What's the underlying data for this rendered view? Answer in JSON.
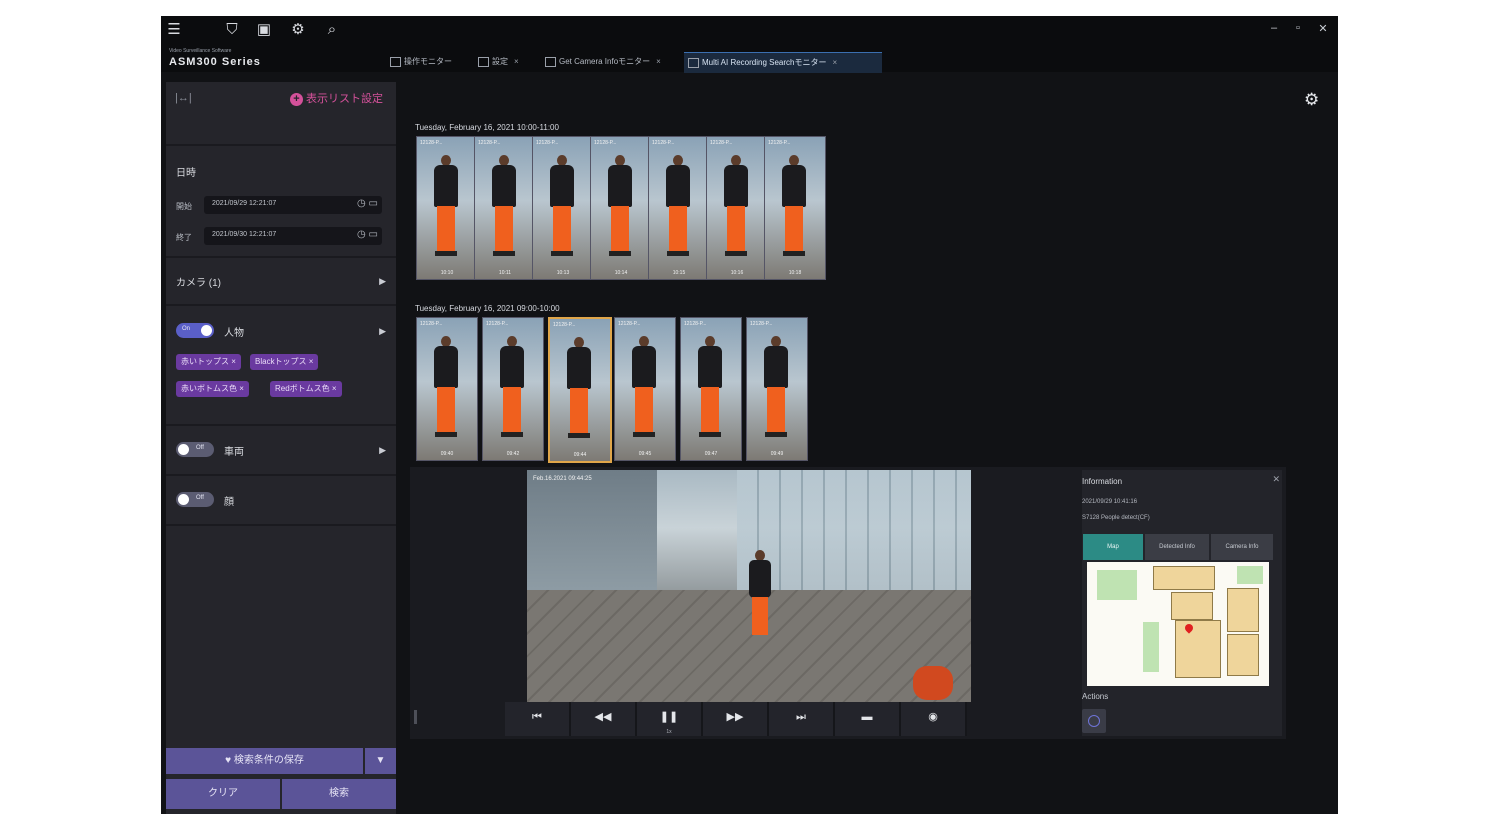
{
  "app": {
    "brand_small": "Video Surveillance Software",
    "brand": "ASM300 Series"
  },
  "toolbar": {
    "icons": [
      "menu-icon",
      "shield-icon",
      "monitor-icon",
      "gear-icon",
      "search-icon"
    ]
  },
  "tabs": [
    {
      "label": "操作モニター",
      "active": false
    },
    {
      "label": "設定",
      "active": false
    },
    {
      "label": "Get Camera Infoモニター",
      "active": false
    },
    {
      "label": "Multi AI Recording Searchモニター",
      "active": true
    }
  ],
  "left": {
    "add_label": "表示リスト設定",
    "datetime_title": "日時",
    "start_label": "開始",
    "start_value": "2021/09/29   12:21:07",
    "end_label": "終了",
    "end_value": "2021/09/30   12:21:07",
    "camera_label": "カメラ (1)",
    "person_label": "人物",
    "person_toggle": "On",
    "chips": [
      "赤いトップス",
      "Blackトップス",
      "赤いボトムス色",
      "Redボトムス色"
    ],
    "vehicle_label": "車両",
    "vehicle_toggle": "Off",
    "face_label": "顔",
    "face_toggle": "Off",
    "save_label": "検索条件の保存",
    "clear_label": "クリア",
    "search_label": "検索"
  },
  "results": {
    "group1_label": "Tuesday, February 16, 2021 10:00-11:00",
    "group1_caps": [
      "12128-P...",
      "12128-P...",
      "12128-P...",
      "12128-P...",
      "12128-P...",
      "12128-P...",
      "12128-P..."
    ],
    "group1_times": [
      "10:10",
      "10:11",
      "10:13",
      "10:14",
      "10:15",
      "10:16",
      "10:18"
    ],
    "group2_label": "Tuesday, February 16, 2021 09:00-10:00",
    "group2_caps": [
      "12128-P...",
      "12128-P...",
      "12128-P...",
      "12128-P...",
      "12128-P...",
      "12128-P..."
    ],
    "group2_times": [
      "09:40",
      "09:42",
      "09:44",
      "09:45",
      "09:47",
      "09:49"
    ],
    "selected_index_group2": 2
  },
  "player": {
    "camera_caption": "Feb.16.2021  09:44:25",
    "speed_label": "1x",
    "control_icons": [
      "skip-start-icon",
      "rewind-icon",
      "pause-icon",
      "fast-forward-icon",
      "skip-end-icon",
      "window-icon",
      "camera-icon"
    ]
  },
  "info": {
    "title": "Information",
    "time": "2021/09/29 10:41:16",
    "camera": "S7128 People detect(CF)",
    "tabs": [
      "Map",
      "Detected Info",
      "Camera Info"
    ],
    "active_tab": "Map",
    "actions_label": "Actions"
  }
}
